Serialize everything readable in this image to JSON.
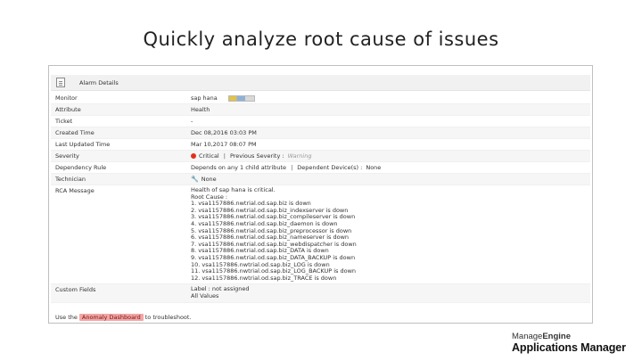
{
  "slide": {
    "title": "Quickly analyze root cause of issues"
  },
  "panel": {
    "header": "Alarm Details",
    "rows": {
      "monitor": {
        "label": "Monitor",
        "value": "sap hana"
      },
      "attribute": {
        "label": "Attribute",
        "value": "Health"
      },
      "ticket": {
        "label": "Ticket",
        "value": "-"
      },
      "created": {
        "label": "Created Time",
        "value": "Dec 08,2016 03:03 PM"
      },
      "updated": {
        "label": "Last Updated Time",
        "value": "Mar 10,2017 08:07 PM"
      },
      "severity": {
        "label": "Severity",
        "current": "Critical",
        "separator": "|",
        "previous_label": "Previous Severity :",
        "previous": "Warning"
      },
      "dependency": {
        "label": "Dependency Rule",
        "part1": "Depends on any 1 child attribute",
        "separator": "|",
        "part2": "Dependent Device(s) :",
        "part3": "None"
      },
      "technician": {
        "label": "Technician",
        "value": "None"
      },
      "rca": {
        "label": "RCA Message",
        "intro": "Health of sap hana is critical.",
        "root_cause_label": "Root Cause :",
        "items": [
          "1. vsa1157886.nwtrial.od.sap.biz is down",
          "2. vsa1157886.nwtrial.od.sap.biz_indexserver is down",
          "3. vsa1157886.nwtrial.od.sap.biz_compileserver is down",
          "4. vsa1157886.nwtrial.od.sap.biz_daemon is down",
          "5. vsa1157886.nwtrial.od.sap.biz_preprocessor is down",
          "6. vsa1157886.nwtrial.od.sap.biz_nameserver is down",
          "7. vsa1157886.nwtrial.od.sap.biz_webdispatcher is down",
          "8. vsa1157886.nwtrial.od.sap.biz_DATA is down",
          "9. vsa1157886.nwtrial.od.sap.biz_DATA_BACKUP is down",
          "10. vsa1157886.nwtrial.od.sap.biz_LOG is down",
          "11. vsa1157886.nwtrial.od.sap.biz_LOG_BACKUP is down",
          "12. vsa1157886.nwtrial.od.sap.biz_TRACE is down"
        ]
      },
      "custom": {
        "label": "Custom Fields",
        "line1": "Label : not assigned",
        "line2": "All Values"
      }
    },
    "footer": {
      "prefix": "Use the",
      "link": "Anomaly Dashboard",
      "suffix": "to troubleshoot."
    }
  },
  "brand": {
    "top_manage": "Manage",
    "top_engine": "Engine",
    "bottom": "Applications Manager"
  },
  "colors": {
    "critical": "#e0321c",
    "anomaly_highlight": "#f2a6a6"
  },
  "icons": {
    "header": "document-icon",
    "monitor": "monitor-type-icon",
    "severity": "critical-status-icon",
    "technician": "wrench-icon"
  }
}
